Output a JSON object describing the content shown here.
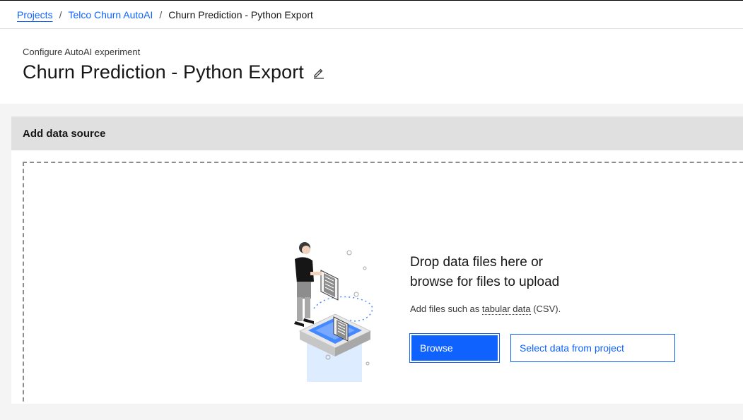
{
  "breadcrumb": {
    "items": [
      {
        "label": "Projects"
      },
      {
        "label": "Telco Churn AutoAI"
      },
      {
        "label": "Churn Prediction - Python Export"
      }
    ],
    "separator": "/"
  },
  "header": {
    "subtitle": "Configure AutoAI experiment",
    "title": "Churn Prediction - Python Export",
    "edit_icon": "pencil-icon"
  },
  "panel": {
    "title": "Add data source",
    "drop_line1": "Drop data files here or",
    "drop_line2": "browse for files to upload",
    "hint_prefix": "Add files such as",
    "hint_link": "tabular data",
    "hint_suffix": "(CSV).",
    "browse_label": "Browse",
    "select_label": "Select data from project"
  },
  "colors": {
    "accent": "#0f62fe",
    "panel_header_bg": "#e0e0e0",
    "page_bg": "#f4f4f4"
  }
}
